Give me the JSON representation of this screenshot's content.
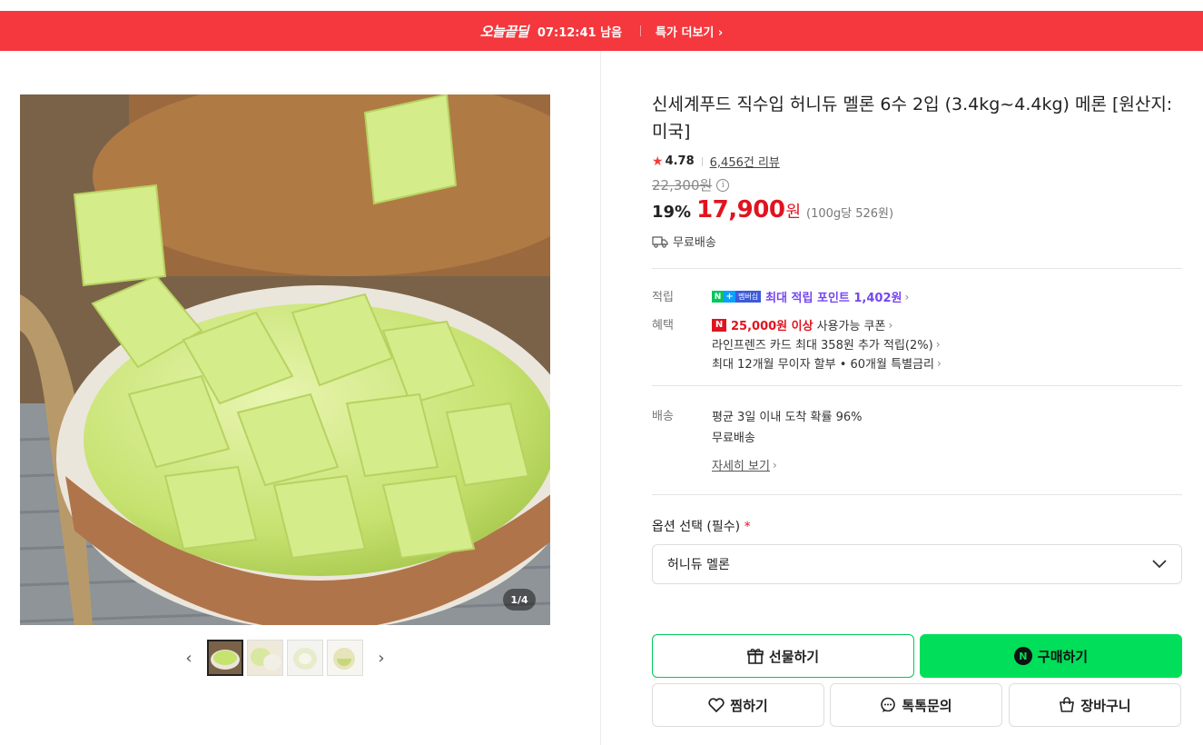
{
  "deal_bar": {
    "logo": "오늘끝딜",
    "timer": "07:12:41 남음",
    "more_label": "특가 더보기",
    "color": "#f4383e"
  },
  "gallery": {
    "counter": "1/4",
    "thumbnail_count": 4,
    "active_index": 0
  },
  "product": {
    "title": "신세계푸드 직수입 허니듀 멜론 6수 2입 (3.4kg~4.4kg) 메론 [원산지: 미국]",
    "rating": "4.78",
    "review_count": "6,456건 리뷰",
    "original_price": "22,300원",
    "discount": "19%",
    "price": "17,900",
    "currency": "원",
    "unit_price": "(100g당 526원)",
    "shipping": "무료배송"
  },
  "points": {
    "label": "적립",
    "membership_badge": "멤버십",
    "text": "최대 적립 포인트 1,402원"
  },
  "benefits": {
    "label": "혜택",
    "coupon_amount": "25,000원 이상",
    "coupon_text": "사용가능 쿠폰",
    "card_text": "라인프렌즈 카드 최대 358원 추가 적립(2%)",
    "installment_text": "최대 12개월 무이자 할부 • 60개월 특별금리"
  },
  "delivery": {
    "label": "배송",
    "arrival_text": "평균 3일 이내 도착 확률 96%",
    "fee_text": "무료배송",
    "detail_link": "자세히 보기"
  },
  "option": {
    "label": "옵션 선택 (필수)",
    "required_mark": "*",
    "selected": "허니듀 멜론"
  },
  "buttons": {
    "gift": "선물하기",
    "buy": "구매하기",
    "wish": "찜하기",
    "talk": "톡톡문의",
    "cart": "장바구니"
  },
  "colors": {
    "price_red": "#e0141f",
    "naver_green": "#03c75a",
    "buy_green": "#00de5a",
    "points_purple": "#7546f0"
  }
}
